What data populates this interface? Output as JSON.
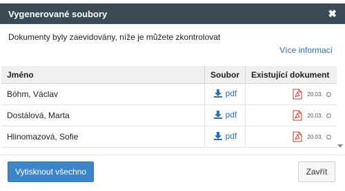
{
  "dialog": {
    "title": "Vygenerované soubory",
    "description": "Dokumenty byly zaevidovány, níže je můžete zkontrolovat",
    "more_info": "Více informací"
  },
  "table": {
    "headers": [
      "Jméno",
      "Soubor",
      "Existující dokument"
    ],
    "rows": [
      {
        "name": "Böhm, Václav",
        "file": "pdf",
        "date": "20.03."
      },
      {
        "name": "Dostálová, Marta",
        "file": "pdf",
        "date": "20.03."
      },
      {
        "name": "Hlinomazová, Sofie",
        "file": "pdf",
        "date": "20.03."
      }
    ]
  },
  "buttons": {
    "print_all": "Vytisknout všechno",
    "close": "Zavřít"
  },
  "icons": {
    "close": "close-icon",
    "download": "download-icon",
    "pdf_document": "pdf-document-icon"
  },
  "colors": {
    "header_bg": "#3b4a57",
    "accent": "#3a86c8",
    "link": "#2f6fb0",
    "pdf_red": "#c0392b"
  }
}
